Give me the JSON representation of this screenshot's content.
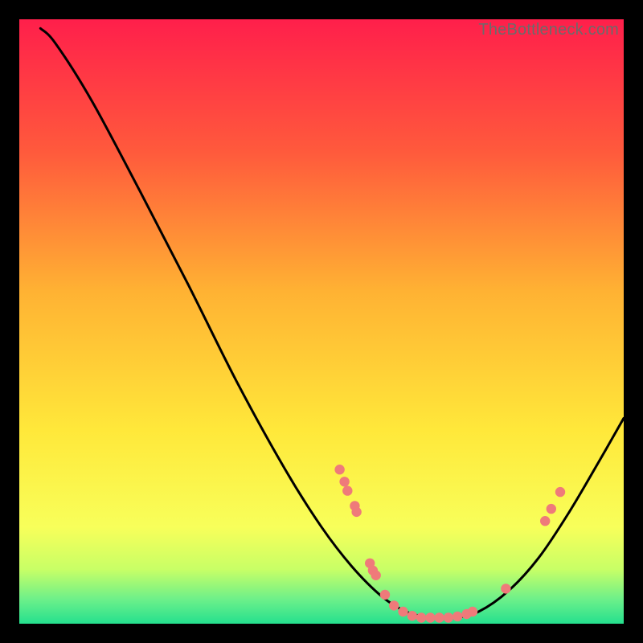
{
  "watermark": "TheBottleneck.com",
  "chart_data": {
    "type": "line",
    "title": "",
    "xlabel": "",
    "ylabel": "",
    "xlim": [
      0,
      100
    ],
    "ylim": [
      0,
      100
    ],
    "gradient_stops": [
      {
        "offset": 0,
        "color": "#ff1f4b"
      },
      {
        "offset": 22,
        "color": "#ff5a3c"
      },
      {
        "offset": 45,
        "color": "#ffb233"
      },
      {
        "offset": 68,
        "color": "#ffe83a"
      },
      {
        "offset": 84,
        "color": "#f8ff5a"
      },
      {
        "offset": 91,
        "color": "#c8ff66"
      },
      {
        "offset": 96,
        "color": "#6cf08a"
      },
      {
        "offset": 100,
        "color": "#25e08e"
      }
    ],
    "series": [
      {
        "name": "bottleneck-curve",
        "type": "line",
        "color": "#000000",
        "points": [
          {
            "x": 3.5,
            "y": 98.5
          },
          {
            "x": 6.0,
            "y": 96.0
          },
          {
            "x": 12.0,
            "y": 86.5
          },
          {
            "x": 20.0,
            "y": 71.5
          },
          {
            "x": 28.0,
            "y": 56.0
          },
          {
            "x": 36.0,
            "y": 40.0
          },
          {
            "x": 44.0,
            "y": 25.5
          },
          {
            "x": 50.0,
            "y": 16.0
          },
          {
            "x": 55.0,
            "y": 9.5
          },
          {
            "x": 60.0,
            "y": 4.5
          },
          {
            "x": 64.0,
            "y": 2.0
          },
          {
            "x": 68.0,
            "y": 1.0
          },
          {
            "x": 72.0,
            "y": 1.0
          },
          {
            "x": 76.0,
            "y": 2.0
          },
          {
            "x": 81.0,
            "y": 5.5
          },
          {
            "x": 86.0,
            "y": 11.0
          },
          {
            "x": 91.0,
            "y": 18.5
          },
          {
            "x": 96.0,
            "y": 27.0
          },
          {
            "x": 100.0,
            "y": 34.0
          }
        ]
      },
      {
        "name": "marker-dots",
        "type": "scatter",
        "color": "#ef7a7a",
        "points": [
          {
            "x": 53.0,
            "y": 25.5
          },
          {
            "x": 53.8,
            "y": 23.5
          },
          {
            "x": 54.3,
            "y": 22.0
          },
          {
            "x": 55.5,
            "y": 19.5
          },
          {
            "x": 55.8,
            "y": 18.5
          },
          {
            "x": 58.0,
            "y": 10.0
          },
          {
            "x": 58.5,
            "y": 8.8
          },
          {
            "x": 59.0,
            "y": 8.0
          },
          {
            "x": 60.5,
            "y": 4.8
          },
          {
            "x": 62.0,
            "y": 3.0
          },
          {
            "x": 63.5,
            "y": 2.0
          },
          {
            "x": 65.0,
            "y": 1.3
          },
          {
            "x": 66.5,
            "y": 1.0
          },
          {
            "x": 68.0,
            "y": 1.0
          },
          {
            "x": 69.5,
            "y": 1.0
          },
          {
            "x": 71.0,
            "y": 1.0
          },
          {
            "x": 72.5,
            "y": 1.2
          },
          {
            "x": 74.0,
            "y": 1.6
          },
          {
            "x": 75.0,
            "y": 2.0
          },
          {
            "x": 80.5,
            "y": 5.8
          },
          {
            "x": 87.0,
            "y": 17.0
          },
          {
            "x": 88.0,
            "y": 19.0
          },
          {
            "x": 89.5,
            "y": 21.8
          }
        ]
      }
    ]
  }
}
